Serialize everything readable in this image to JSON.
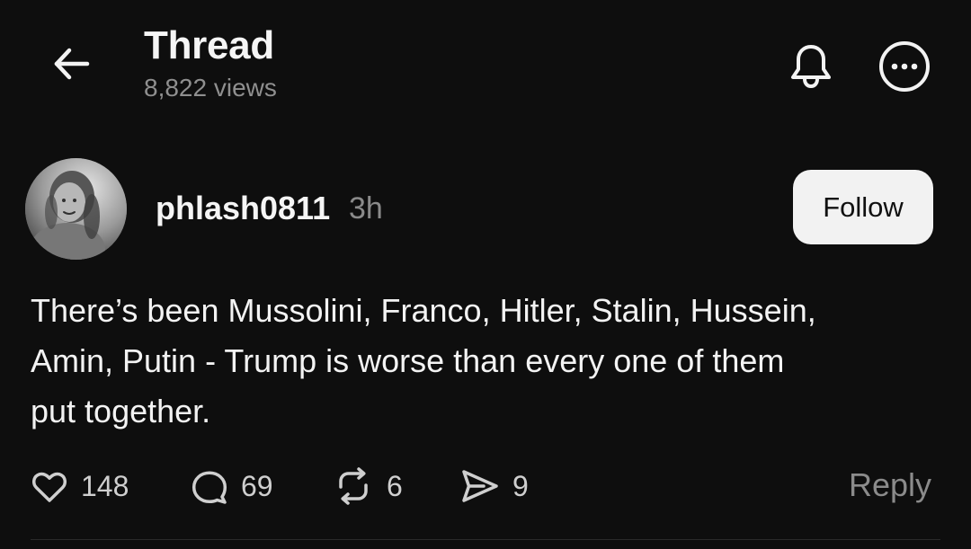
{
  "header": {
    "title": "Thread",
    "views": "8,822 views",
    "back_icon": "arrow-left-icon",
    "notification_icon": "bell-icon",
    "more_icon": "more-horizontal-icon"
  },
  "post": {
    "author": {
      "username": "phlash0811",
      "timestamp": "3h",
      "avatar": "avatar"
    },
    "follow_label": "Follow",
    "text": "There’s been Mussolini, Franco, Hitler, Stalin, Hussein,\nAmin, Putin -  Trump is worse than every one of them\nput together.",
    "actions": {
      "likes": "148",
      "comments": "69",
      "reposts": "6",
      "shares": "9",
      "reply_label": "Reply"
    }
  },
  "colors": {
    "background": "#0e0e0e",
    "text": "#f3f3f3",
    "muted": "#8f8f8f",
    "button_bg": "#f2f2f2"
  }
}
